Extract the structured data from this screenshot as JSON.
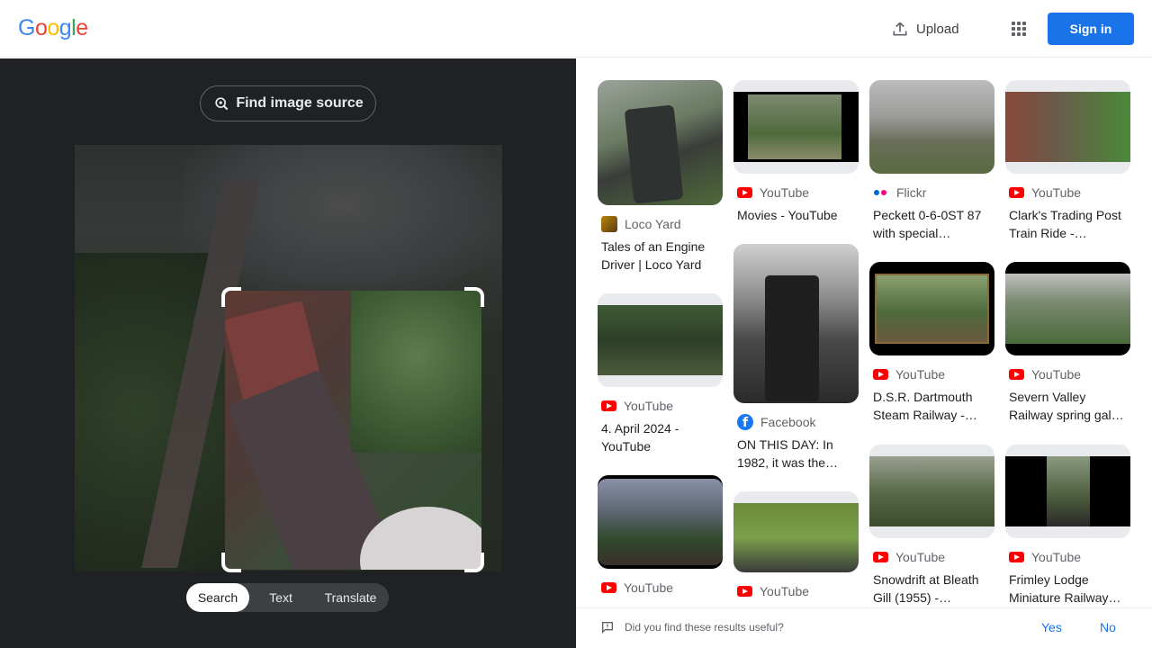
{
  "header": {
    "logo_letters": [
      {
        "ch": "G",
        "color": "#4285f4"
      },
      {
        "ch": "o",
        "color": "#ea4335"
      },
      {
        "ch": "o",
        "color": "#fbbc05"
      },
      {
        "ch": "g",
        "color": "#4285f4"
      },
      {
        "ch": "l",
        "color": "#34a853"
      },
      {
        "ch": "e",
        "color": "#ea4335"
      }
    ],
    "upload_label": "Upload",
    "apps_icon": "apps-grid-icon",
    "signin_label": "Sign in"
  },
  "left_panel": {
    "find_source_label": "Find image source",
    "modes": [
      "Search",
      "Text",
      "Translate"
    ],
    "active_mode": "Search"
  },
  "results": [
    {
      "source": "Loco Yard",
      "source_icon": "loco-yard-icon",
      "title": "Tales of an Engine Driver | Loco Yard"
    },
    {
      "source": "YouTube",
      "source_icon": "youtube-icon",
      "title": "4. April 2024 - YouTube"
    },
    {
      "source": "YouTube",
      "source_icon": "youtube-icon",
      "title": ""
    },
    {
      "source": "YouTube",
      "source_icon": "youtube-icon",
      "title": "Movies - YouTube"
    },
    {
      "source": "Facebook",
      "source_icon": "facebook-icon",
      "title": "ON THIS DAY: In 1982, it was the…"
    },
    {
      "source": "YouTube",
      "source_icon": "youtube-icon",
      "title": ""
    },
    {
      "source": "Flickr",
      "source_icon": "flickr-icon",
      "title": "Peckett 0-6-0ST 87 with special…"
    },
    {
      "source": "YouTube",
      "source_icon": "youtube-icon",
      "title": "D.S.R. Dartmouth Steam Railway -…"
    },
    {
      "source": "YouTube",
      "source_icon": "youtube-icon",
      "title": "Snowdrift at Bleath Gill (1955) -…"
    },
    {
      "source": "YouTube",
      "source_icon": "youtube-icon",
      "title": "Clark's Trading Post Train Ride -…"
    },
    {
      "source": "YouTube",
      "source_icon": "youtube-icon",
      "title": "Severn Valley Railway spring gal…"
    },
    {
      "source": "YouTube",
      "source_icon": "youtube-icon",
      "title": "Frimley Lodge Miniature Railway…"
    }
  ],
  "feedback": {
    "question": "Did you find these results useful?",
    "yes_label": "Yes",
    "no_label": "No"
  }
}
